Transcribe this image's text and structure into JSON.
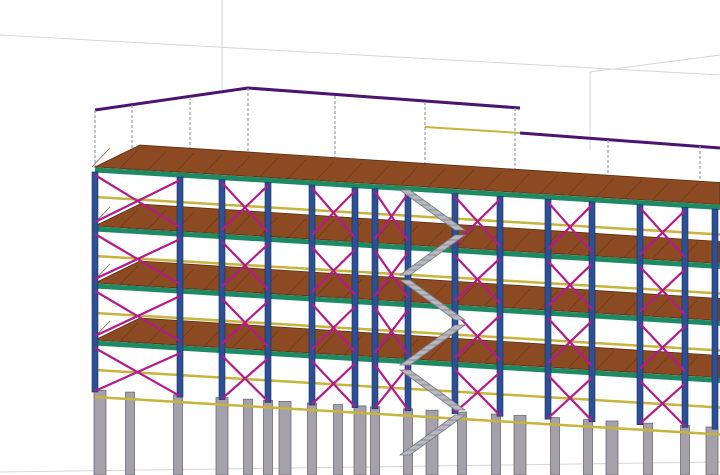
{
  "viewport": {
    "background": "#ffffff",
    "colors": {
      "deck_wood": "#8b4a22",
      "deck_edge": "#1d8a63",
      "edge_beam": "#c8b43c",
      "column": "#2d4f93",
      "brace": "#b21c8a",
      "pile": "#a4a1aa",
      "parapet_beam": "#4a1470",
      "guard_post": "#9aa0aa",
      "stair": "#b8b8c0",
      "grid_line": "#d6d6d6"
    }
  },
  "model": {
    "floors": 4,
    "stair_flights": 6
  }
}
